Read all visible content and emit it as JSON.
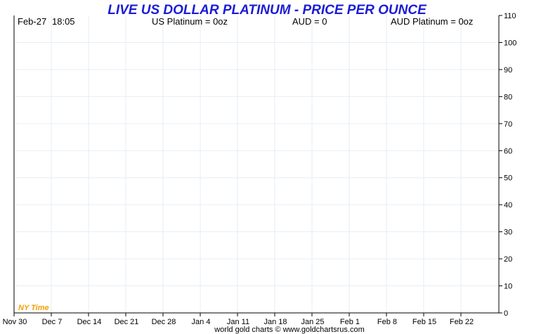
{
  "chart_data": {
    "type": "line",
    "title": "LIVE US DOLLAR PLATINUM - PRICE PER OUNCE",
    "header": {
      "date": "Feb-27",
      "time": "18:05",
      "us_platinum": "US Platinum = 0oz",
      "aud": "AUD = 0",
      "aud_platinum": "AUD Platinum = 0oz"
    },
    "x_tick_labels": [
      "Nov 30",
      "Dec 7",
      "Dec 14",
      "Dec 21",
      "Dec 28",
      "Jan 4",
      "Jan 11",
      "Jan 18",
      "Jan 25",
      "Feb 1",
      "Feb 8",
      "Feb 15",
      "Feb 22"
    ],
    "y_ticks": [
      0,
      10,
      20,
      30,
      40,
      50,
      60,
      70,
      80,
      90,
      100,
      110
    ],
    "ylim": [
      0,
      110
    ],
    "y_axis_side": "right",
    "grid": true,
    "series": [],
    "timezone_label": "NY Time",
    "footer": "world gold charts © www.goldchartsrus.com"
  },
  "colors": {
    "title": "#1c1cd6",
    "timezone_label": "#f0a000",
    "grid": "#e6eef4",
    "axis": "#000000"
  }
}
